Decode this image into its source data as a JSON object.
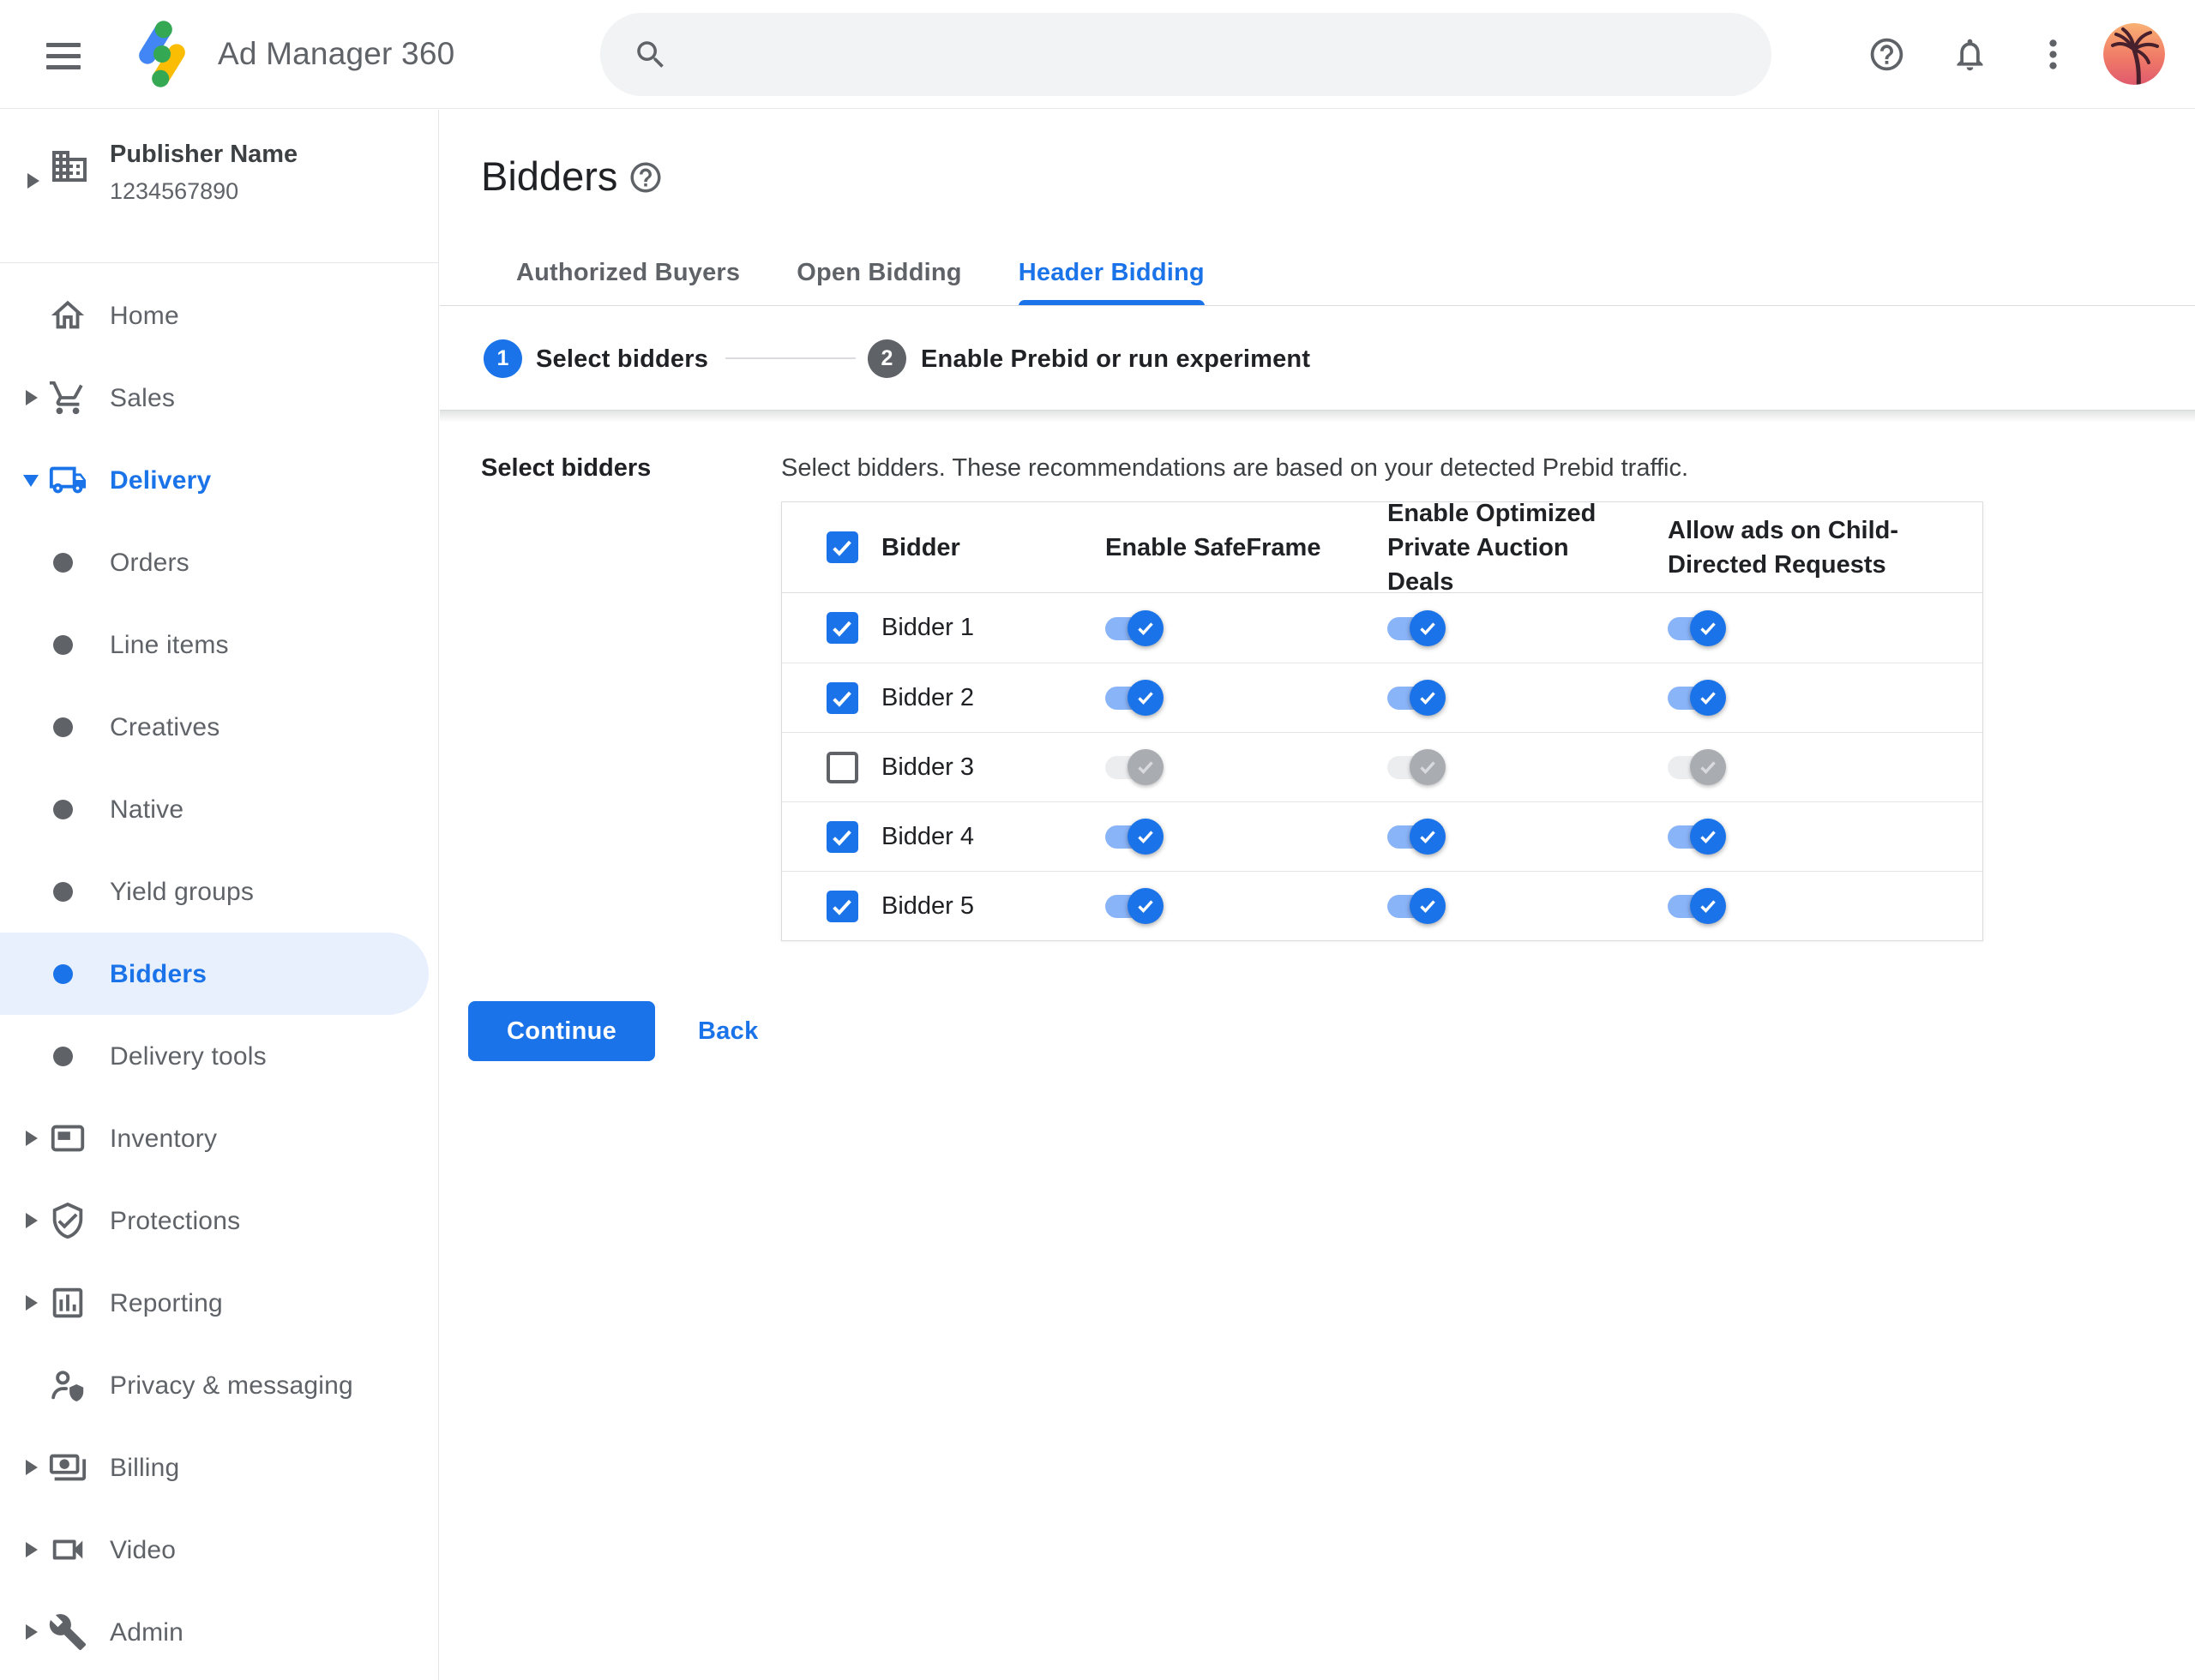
{
  "header": {
    "app_title": "Ad Manager 360",
    "search_placeholder": "",
    "icons": [
      "menu-icon",
      "ad-manager-logo",
      "search-icon",
      "help-icon",
      "notifications-icon",
      "kebab-menu-icon",
      "avatar"
    ]
  },
  "sidebar": {
    "publisher": {
      "name": "Publisher Name",
      "id": "1234567890",
      "icon": "building-icon"
    },
    "items": [
      {
        "label": "Home",
        "icon": "home-icon",
        "level": "top",
        "chevron": "none"
      },
      {
        "label": "Sales",
        "icon": "cart-icon",
        "level": "top",
        "chevron": "right"
      },
      {
        "label": "Delivery",
        "icon": "truck-icon",
        "level": "top",
        "chevron": "down",
        "expanded": true,
        "highlighted": true
      },
      {
        "label": "Orders",
        "icon": "bullet",
        "level": "sub"
      },
      {
        "label": "Line items",
        "icon": "bullet",
        "level": "sub"
      },
      {
        "label": "Creatives",
        "icon": "bullet",
        "level": "sub"
      },
      {
        "label": "Native",
        "icon": "bullet",
        "level": "sub"
      },
      {
        "label": "Yield groups",
        "icon": "bullet",
        "level": "sub"
      },
      {
        "label": "Bidders",
        "icon": "bullet",
        "level": "sub",
        "selected": true
      },
      {
        "label": "Delivery tools",
        "icon": "bullet",
        "level": "sub"
      },
      {
        "label": "Inventory",
        "icon": "inventory-icon",
        "level": "top",
        "chevron": "right"
      },
      {
        "label": "Protections",
        "icon": "shield-check-icon",
        "level": "top",
        "chevron": "right"
      },
      {
        "label": "Reporting",
        "icon": "bar-chart-icon",
        "level": "top",
        "chevron": "right"
      },
      {
        "label": "Privacy & messaging",
        "icon": "person-shield-icon",
        "level": "top",
        "chevron": "none"
      },
      {
        "label": "Billing",
        "icon": "money-icon",
        "level": "top",
        "chevron": "right"
      },
      {
        "label": "Video",
        "icon": "videocam-icon",
        "level": "top",
        "chevron": "right"
      },
      {
        "label": "Admin",
        "icon": "wrench-icon",
        "level": "top",
        "chevron": "right"
      }
    ]
  },
  "main": {
    "page_title": "Bidders",
    "tabs": [
      {
        "label": "Authorized Buyers",
        "active": false
      },
      {
        "label": "Open Bidding",
        "active": false
      },
      {
        "label": "Header Bidding",
        "active": true
      }
    ],
    "stepper": {
      "steps": [
        {
          "number": "1",
          "label": "Select bidders",
          "state": "current"
        },
        {
          "number": "2",
          "label": "Enable Prebid or run experiment",
          "state": "upcoming"
        }
      ]
    },
    "section_label": "Select bidders",
    "description": "Select bidders. These recommendations are based on your detected Prebid traffic.",
    "table": {
      "columns": [
        "Bidder",
        "Enable SafeFrame",
        "Enable Optimized Private Auction Deals",
        "Allow ads on Child-Directed Requests"
      ],
      "select_all_checked": true,
      "rows": [
        {
          "name": "Bidder 1",
          "checked": true,
          "enable_safeframe": true,
          "enable_optimized_deals": true,
          "allow_child_directed": true
        },
        {
          "name": "Bidder 2",
          "checked": true,
          "enable_safeframe": true,
          "enable_optimized_deals": true,
          "allow_child_directed": true
        },
        {
          "name": "Bidder 3",
          "checked": false,
          "enable_safeframe": false,
          "enable_optimized_deals": false,
          "allow_child_directed": false
        },
        {
          "name": "Bidder 4",
          "checked": true,
          "enable_safeframe": true,
          "enable_optimized_deals": true,
          "allow_child_directed": true
        },
        {
          "name": "Bidder 5",
          "checked": true,
          "enable_safeframe": true,
          "enable_optimized_deals": true,
          "allow_child_directed": true
        }
      ]
    },
    "continue_label": "Continue",
    "back_label": "Back"
  },
  "colors": {
    "accent_blue": "#1a73e8",
    "toggle_on_track": "#8ab4f8",
    "toggle_off_thumb": "#a9acb1",
    "selected_item_bg": "#e8f0fe",
    "gray_text": "#5f6368",
    "dark_text": "#202124",
    "divider": "#dadce0",
    "search_bg": "#f1f3f4",
    "step2_circle": "#5f6368",
    "logo_blue": "#4285f4",
    "logo_yellow": "#fbbc04",
    "logo_green": "#34a853"
  }
}
